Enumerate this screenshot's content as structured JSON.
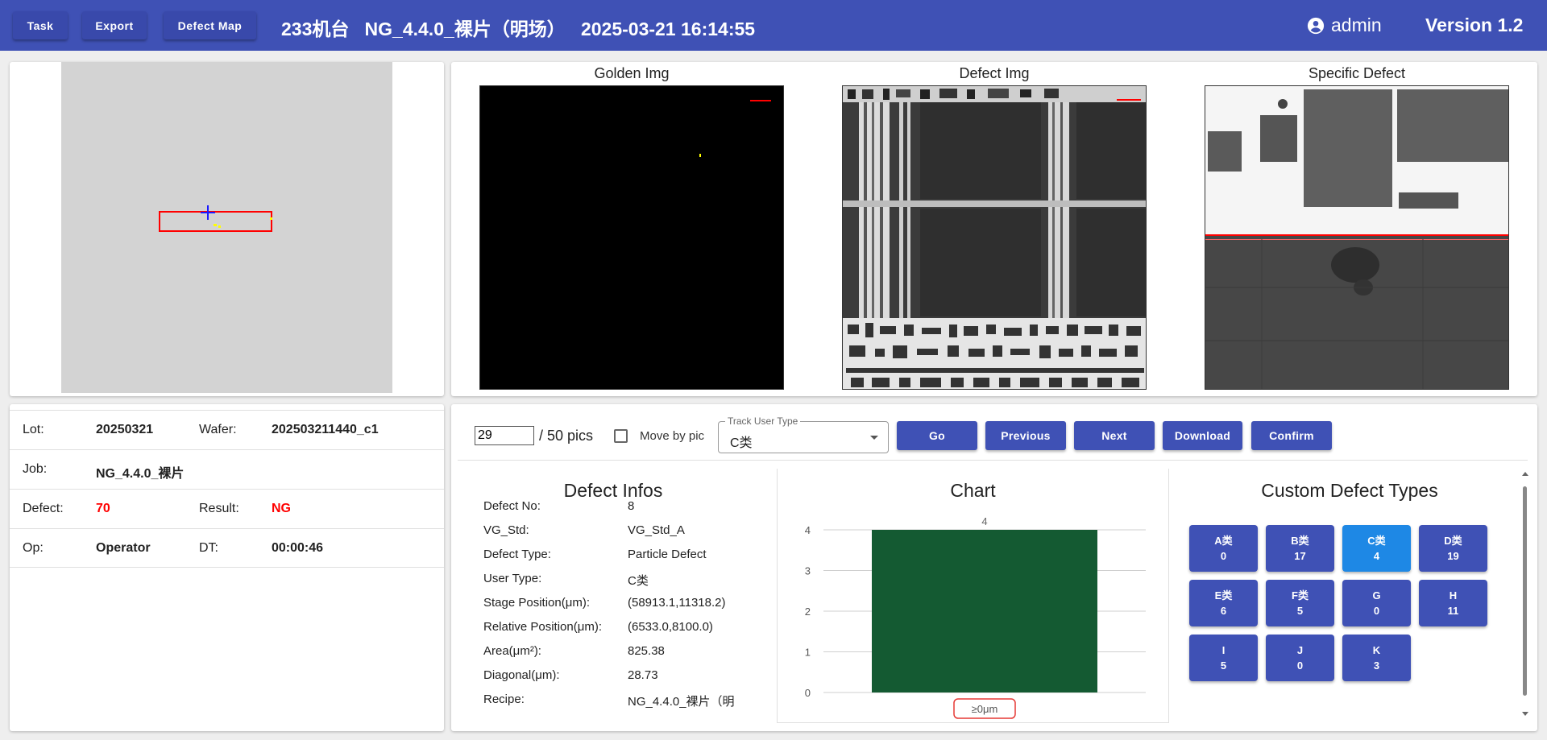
{
  "toolbar": {
    "task_label": "Task",
    "export_label": "Export",
    "defect_map_label": "Defect Map"
  },
  "header": {
    "title": "233机台   NG_4.4.0_裸片（明场）   2025-03-21 16:14:55",
    "user": "admin",
    "version": "Version 1.2"
  },
  "images": {
    "golden_title": "Golden Img",
    "defect_title": "Defect Img",
    "specific_title": "Specific Defect"
  },
  "info": {
    "lot_label": "Lot:",
    "lot_value": "20250321",
    "wafer_label": "Wafer:",
    "wafer_value": "202503211440_c1",
    "job_label": "Job:",
    "job_value": "NG_4.4.0_裸片",
    "defect_label": "Defect:",
    "defect_value": "70",
    "result_label": "Result:",
    "result_value": "NG",
    "op_label": "Op:",
    "op_value": "Operator",
    "dt_label": "DT:",
    "dt_value": "00:00:46"
  },
  "nav": {
    "pic_value": "29",
    "pic_total": "/ 50 pics",
    "move_by_pic": "Move by pic",
    "track_legend": "Track User Type",
    "track_value": "C类",
    "go": "Go",
    "previous": "Previous",
    "next": "Next",
    "download": "Download",
    "confirm": "Confirm"
  },
  "defect_infos": {
    "title": "Defect Infos",
    "rows": [
      {
        "label": "Defect No:",
        "value": "8"
      },
      {
        "label": "VG_Std:",
        "value": "VG_Std_A"
      },
      {
        "label": "Defect Type:",
        "value": "Particle Defect"
      },
      {
        "label": "User Type:",
        "value": "C类"
      },
      {
        "label": "Stage Position(μm):",
        "value": "(58913.1,11318.2)"
      },
      {
        "label": "Relative Position(μm):",
        "value": "(6533.0,8100.0)"
      },
      {
        "label": "Area(μm²):",
        "value": "825.38"
      },
      {
        "label": "Diagonal(μm):",
        "value": "28.73"
      },
      {
        "label": "Recipe:",
        "value": "NG_4.4.0_裸片（明"
      }
    ]
  },
  "chart_title": "Chart",
  "chart_data": {
    "type": "bar",
    "categories": [
      "≥0μm"
    ],
    "values": [
      4
    ],
    "ylim": [
      0,
      4
    ],
    "yticks": [
      0,
      1,
      2,
      3,
      4
    ],
    "data_labels": [
      "4"
    ],
    "bar_color": "#145a32",
    "grid": true
  },
  "custom_types": {
    "title": "Custom Defect Types",
    "items": [
      {
        "name": "A类",
        "count": "0",
        "selected": false
      },
      {
        "name": "B类",
        "count": "17",
        "selected": false
      },
      {
        "name": "C类",
        "count": "4",
        "selected": true
      },
      {
        "name": "D类",
        "count": "19",
        "selected": false
      },
      {
        "name": "E类",
        "count": "6",
        "selected": false
      },
      {
        "name": "F类",
        "count": "5",
        "selected": false
      },
      {
        "name": "G",
        "count": "0",
        "selected": false
      },
      {
        "name": "H",
        "count": "11",
        "selected": false
      },
      {
        "name": "I",
        "count": "5",
        "selected": false
      },
      {
        "name": "J",
        "count": "0",
        "selected": false
      },
      {
        "name": "K",
        "count": "3",
        "selected": false
      }
    ]
  },
  "colors": {
    "primary": "#3f51b5",
    "selected": "#1e88e5",
    "ng_red": "#ff0000",
    "bar": "#145a32"
  },
  "icons": {
    "user": "account-circle-icon",
    "dropdown": "chevron-down-icon"
  }
}
